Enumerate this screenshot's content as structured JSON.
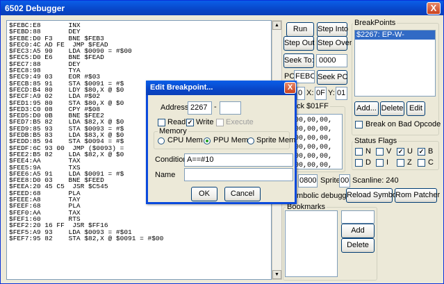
{
  "window": {
    "title": "6502 Debugger",
    "close_label": "X"
  },
  "disassembly": [
    "$FEBC:E8       INX",
    "$FEBD:88       DEY",
    "$FEBE:D0 F3    BNE $FEB3",
    "$FEC0:4C AD FE  JMP $FEAD",
    "$FEC3:A5 90    LDA $0090 = #$00",
    "$FEC5:D0 E6    BNE $FEAD",
    "$FEC7:88       DEY",
    "$FEC8:98       TYA",
    "$FEC9:49 03    EOR #$03",
    "$FECB:85 91    STA $0091 = #$",
    "$FECD:B4 80    LDY $80,X @ $0",
    "$FECF:A9 02    LDA #$02",
    "$FED1:95 80    STA $80,X @ $0",
    "$FED3:C0 08    CPY #$08",
    "$FED5:D0 0B    BNE $FEE2",
    "$FED7:B5 82    LDA $82,X @ $0",
    "$FED9:85 93    STA $0093 = #$",
    "$FEDB:B5 83    LDA $83,X @ $0",
    "$FEDD:85 94    STA $0094 = #$",
    "$FEDF:6C 93 00  JMP ($0093) =",
    "$FEE2:B5 82    LDA $82,X @ $0",
    "$FEE4:AA       TAX",
    "$FEE5:9A       TXS",
    "$FEE6:A5 91    LDA $0091 = #$",
    "$FEE8:D0 03    BNE $FEED",
    "$FEEA:20 45 C5  JSR $C545",
    "$FEED:68       PLA",
    "$FEEE:A8       TAY",
    "$FEEF:68       PLA",
    "$FEF0:AA       TAX",
    "$FEF1:60       RTS",
    "$FEF2:20 16 FF  JSR $FF16",
    "$FEF5:A9 93    LDA $0093 = #$01",
    "$FEF7:95 82    STA $82,X @ $0091 = #$00"
  ],
  "scroll": {
    "up": "▲",
    "down": "▼"
  },
  "controls": {
    "run": "Run",
    "step_into": "Step Into",
    "step_out": "Step Out",
    "step_over": "Step Over",
    "seek_to": "Seek To:",
    "seek_value": "0000",
    "pc_label": "PC:",
    "pc_value": "FEBC",
    "seek_pc": "Seek PC",
    "a_value": "0",
    "x_label": "X:",
    "x_value": "0F",
    "y_label": "Y:",
    "y_value": "01",
    "stack_label": "ck $01FF",
    "stack_rows": [
      ",00,00,00,",
      ",00,00,00,",
      ",00,00,00,",
      ",00,00,00,",
      ",00,00,00,",
      ",00,00,00,"
    ],
    "ppu_value": "0800",
    "sprite_label": "Sprite:",
    "sprite_value": "00",
    "scanline": "Scanline: 240",
    "symbolic": "mbolic debugging",
    "reload_symbols": "Reload Symbols",
    "rom_patcher": "Rom Patcher"
  },
  "breakpoints": {
    "group_label": "BreakPoints",
    "items": [
      "$2267: EP-W-"
    ],
    "add": "Add...",
    "delete": "Delete",
    "edit": "Edit",
    "break_bad_opcode": "Break on Bad Opcode"
  },
  "status_flags": {
    "label": "Status Flags",
    "flags": [
      {
        "name": "N",
        "checked": false
      },
      {
        "name": "V",
        "checked": false
      },
      {
        "name": "U",
        "checked": true
      },
      {
        "name": "B",
        "checked": true
      },
      {
        "name": "D",
        "checked": false
      },
      {
        "name": "I",
        "checked": false
      },
      {
        "name": "Z",
        "checked": false
      },
      {
        "name": "C",
        "checked": false
      }
    ]
  },
  "bookmarks": {
    "label": "Bookmarks",
    "add": "Add",
    "delete": "Delete",
    "input_value": ""
  },
  "dialog": {
    "title": "Edit Breakpoint...",
    "close_label": "X",
    "address_label": "Address:",
    "address_value": "2267",
    "address_sep": "-",
    "address_end": "",
    "read": "Read",
    "write": "Write",
    "execute": "Execute",
    "read_checked": false,
    "write_checked": true,
    "memory_label": "Memory",
    "cpu_mem": "CPU Mem",
    "ppu_mem": "PPU Mem",
    "sprite_mem": "Sprite Mem",
    "selected_memory": "PPU Mem",
    "condition_label": "Condition",
    "condition_value": "A==#10",
    "name_label": "Name",
    "name_value": "",
    "ok": "OK",
    "cancel": "Cancel"
  }
}
